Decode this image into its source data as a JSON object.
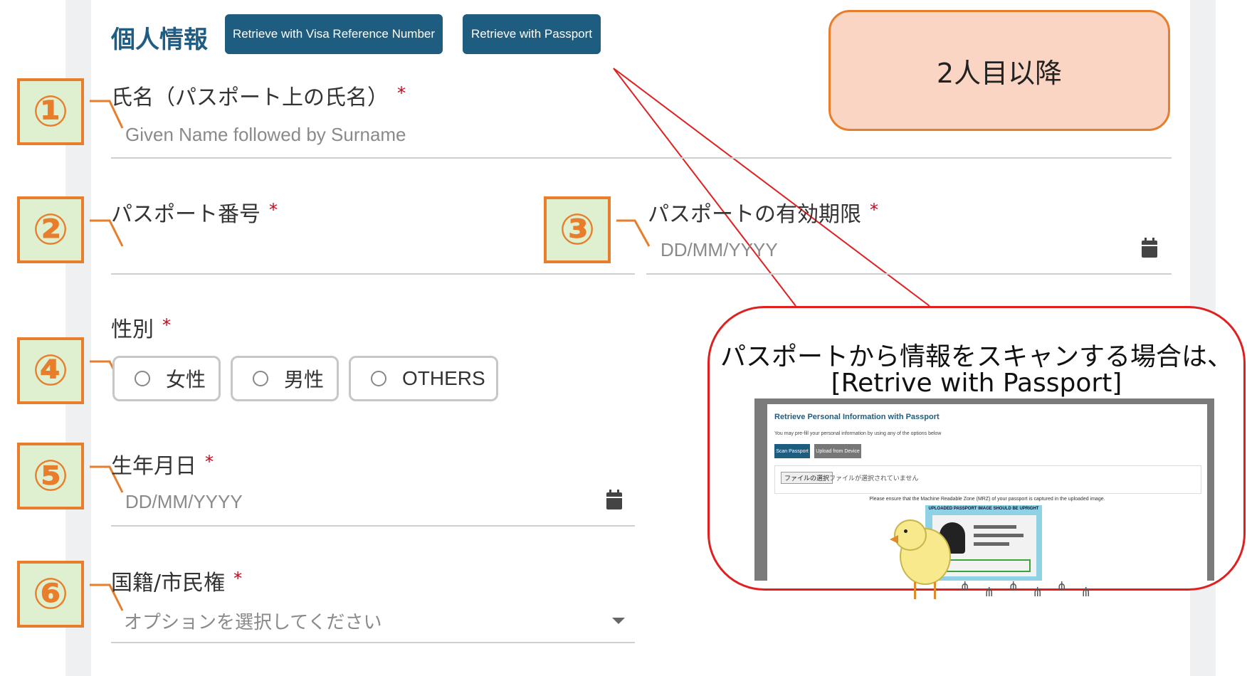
{
  "header": {
    "title": "個人情報",
    "btn_visa": "Retrieve with Visa Reference Number",
    "btn_passport": "Retrieve with Passport"
  },
  "callout_top": {
    "text": "2人目以降"
  },
  "fields": {
    "name": {
      "label": "氏名（パスポート上の氏名）",
      "placeholder": "Given Name followed by Surname"
    },
    "passport_no": {
      "label": "パスポート番号"
    },
    "passport_expiry": {
      "label": "パスポートの有効期限",
      "placeholder": "DD/MM/YYYY"
    },
    "gender": {
      "label": "性別",
      "options": [
        "女性",
        "男性",
        "OTHERS"
      ]
    },
    "dob": {
      "label": "生年月日",
      "placeholder": "DD/MM/YYYY"
    },
    "nationality": {
      "label": "国籍/市民権",
      "placeholder": "オプションを選択してください"
    }
  },
  "required_mark": "*",
  "markers": [
    "①",
    "②",
    "③",
    "④",
    "⑤",
    "⑥"
  ],
  "bubble": {
    "line1": "パスポートから情報をスキャンする場合は、",
    "line2": "[Retrive with Passport]"
  },
  "mini_screen": {
    "title": "Retrieve Personal Information with Passport",
    "subtitle": "You may pre-fill your personal information by using any of the options below",
    "btn_scan": "Scan Passport",
    "btn_upload": "Upload from Device",
    "file_btn": "ファイルの選択",
    "file_text": "ファイルが選択されていません",
    "note": "Please ensure that the Machine Readable Zone (MRZ) of your passport is captured in the uploaded image.",
    "passport_label": "UPLOADED PASSPORT IMAGE SHOULD BE UPRIGHT"
  },
  "colors": {
    "accent": "#1e5c80",
    "marker_border": "#e87d2b",
    "marker_fill": "#dff0d0",
    "callout_fill": "#fbd5c3",
    "bubble_border": "#e02020",
    "required": "#d0021b"
  }
}
